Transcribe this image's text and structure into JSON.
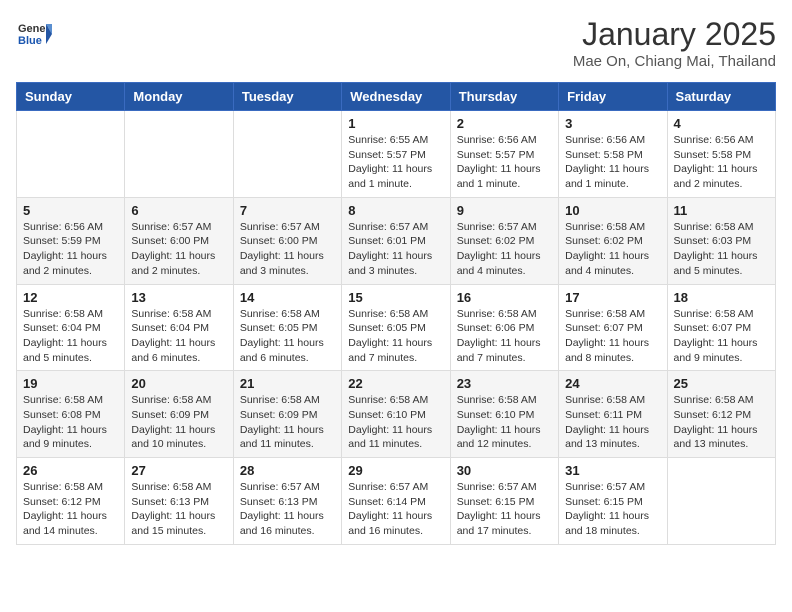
{
  "header": {
    "logo_general": "General",
    "logo_blue": "Blue",
    "title": "January 2025",
    "subtitle": "Mae On, Chiang Mai, Thailand"
  },
  "days_of_week": [
    "Sunday",
    "Monday",
    "Tuesday",
    "Wednesday",
    "Thursday",
    "Friday",
    "Saturday"
  ],
  "weeks": [
    [
      {
        "day": "",
        "text": ""
      },
      {
        "day": "",
        "text": ""
      },
      {
        "day": "",
        "text": ""
      },
      {
        "day": "1",
        "text": "Sunrise: 6:55 AM\nSunset: 5:57 PM\nDaylight: 11 hours and 1 minute."
      },
      {
        "day": "2",
        "text": "Sunrise: 6:56 AM\nSunset: 5:57 PM\nDaylight: 11 hours and 1 minute."
      },
      {
        "day": "3",
        "text": "Sunrise: 6:56 AM\nSunset: 5:58 PM\nDaylight: 11 hours and 1 minute."
      },
      {
        "day": "4",
        "text": "Sunrise: 6:56 AM\nSunset: 5:58 PM\nDaylight: 11 hours and 2 minutes."
      }
    ],
    [
      {
        "day": "5",
        "text": "Sunrise: 6:56 AM\nSunset: 5:59 PM\nDaylight: 11 hours and 2 minutes."
      },
      {
        "day": "6",
        "text": "Sunrise: 6:57 AM\nSunset: 6:00 PM\nDaylight: 11 hours and 2 minutes."
      },
      {
        "day": "7",
        "text": "Sunrise: 6:57 AM\nSunset: 6:00 PM\nDaylight: 11 hours and 3 minutes."
      },
      {
        "day": "8",
        "text": "Sunrise: 6:57 AM\nSunset: 6:01 PM\nDaylight: 11 hours and 3 minutes."
      },
      {
        "day": "9",
        "text": "Sunrise: 6:57 AM\nSunset: 6:02 PM\nDaylight: 11 hours and 4 minutes."
      },
      {
        "day": "10",
        "text": "Sunrise: 6:58 AM\nSunset: 6:02 PM\nDaylight: 11 hours and 4 minutes."
      },
      {
        "day": "11",
        "text": "Sunrise: 6:58 AM\nSunset: 6:03 PM\nDaylight: 11 hours and 5 minutes."
      }
    ],
    [
      {
        "day": "12",
        "text": "Sunrise: 6:58 AM\nSunset: 6:04 PM\nDaylight: 11 hours and 5 minutes."
      },
      {
        "day": "13",
        "text": "Sunrise: 6:58 AM\nSunset: 6:04 PM\nDaylight: 11 hours and 6 minutes."
      },
      {
        "day": "14",
        "text": "Sunrise: 6:58 AM\nSunset: 6:05 PM\nDaylight: 11 hours and 6 minutes."
      },
      {
        "day": "15",
        "text": "Sunrise: 6:58 AM\nSunset: 6:05 PM\nDaylight: 11 hours and 7 minutes."
      },
      {
        "day": "16",
        "text": "Sunrise: 6:58 AM\nSunset: 6:06 PM\nDaylight: 11 hours and 7 minutes."
      },
      {
        "day": "17",
        "text": "Sunrise: 6:58 AM\nSunset: 6:07 PM\nDaylight: 11 hours and 8 minutes."
      },
      {
        "day": "18",
        "text": "Sunrise: 6:58 AM\nSunset: 6:07 PM\nDaylight: 11 hours and 9 minutes."
      }
    ],
    [
      {
        "day": "19",
        "text": "Sunrise: 6:58 AM\nSunset: 6:08 PM\nDaylight: 11 hours and 9 minutes."
      },
      {
        "day": "20",
        "text": "Sunrise: 6:58 AM\nSunset: 6:09 PM\nDaylight: 11 hours and 10 minutes."
      },
      {
        "day": "21",
        "text": "Sunrise: 6:58 AM\nSunset: 6:09 PM\nDaylight: 11 hours and 11 minutes."
      },
      {
        "day": "22",
        "text": "Sunrise: 6:58 AM\nSunset: 6:10 PM\nDaylight: 11 hours and 11 minutes."
      },
      {
        "day": "23",
        "text": "Sunrise: 6:58 AM\nSunset: 6:10 PM\nDaylight: 11 hours and 12 minutes."
      },
      {
        "day": "24",
        "text": "Sunrise: 6:58 AM\nSunset: 6:11 PM\nDaylight: 11 hours and 13 minutes."
      },
      {
        "day": "25",
        "text": "Sunrise: 6:58 AM\nSunset: 6:12 PM\nDaylight: 11 hours and 13 minutes."
      }
    ],
    [
      {
        "day": "26",
        "text": "Sunrise: 6:58 AM\nSunset: 6:12 PM\nDaylight: 11 hours and 14 minutes."
      },
      {
        "day": "27",
        "text": "Sunrise: 6:58 AM\nSunset: 6:13 PM\nDaylight: 11 hours and 15 minutes."
      },
      {
        "day": "28",
        "text": "Sunrise: 6:57 AM\nSunset: 6:13 PM\nDaylight: 11 hours and 16 minutes."
      },
      {
        "day": "29",
        "text": "Sunrise: 6:57 AM\nSunset: 6:14 PM\nDaylight: 11 hours and 16 minutes."
      },
      {
        "day": "30",
        "text": "Sunrise: 6:57 AM\nSunset: 6:15 PM\nDaylight: 11 hours and 17 minutes."
      },
      {
        "day": "31",
        "text": "Sunrise: 6:57 AM\nSunset: 6:15 PM\nDaylight: 11 hours and 18 minutes."
      },
      {
        "day": "",
        "text": ""
      }
    ]
  ]
}
